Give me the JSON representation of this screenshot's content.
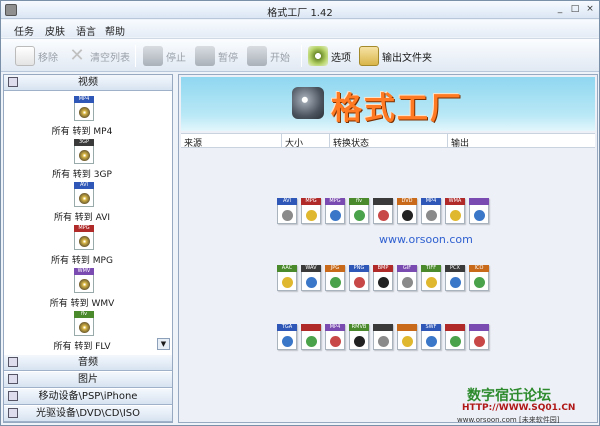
{
  "window": {
    "title": "格式工厂 1.42",
    "minimize": "_",
    "maximize": "□",
    "close": "×"
  },
  "menu": [
    "任务",
    "皮肤",
    "语言",
    "帮助"
  ],
  "toolbar": {
    "remove": "移除",
    "clear_list": "清空列表",
    "stop": "停止",
    "pause": "暂停",
    "start": "开始",
    "options": "选项",
    "output_folder": "输出文件夹"
  },
  "sidebar": {
    "video_section": "视频",
    "conversions": [
      {
        "label": "所有 转到 MP4",
        "tag": "MP4",
        "color": "#2f57b8"
      },
      {
        "label": "所有 转到 3GP",
        "tag": "3GP",
        "color": "#3a3a3a"
      },
      {
        "label": "所有 转到 AVI",
        "tag": "AVI",
        "color": "#2f57b8"
      },
      {
        "label": "所有 转到 MPG",
        "tag": "MPG",
        "color": "#b02a2a"
      },
      {
        "label": "所有 转到 WMV",
        "tag": "WMV",
        "color": "#7a4bb0"
      },
      {
        "label": "所有 转到 FLV",
        "tag": "flv",
        "color": "#4a8a2c"
      }
    ],
    "audio_section": "音频",
    "image_section": "图片",
    "mobile_section": "移动设备\\PSP\\iPhone",
    "disc_section": "光驱设备\\DVD\\CD\\ISO"
  },
  "banner": {
    "logo_text": "格式工厂"
  },
  "columns": [
    "来源",
    "大小",
    "转换状态",
    "输出"
  ],
  "icon_rows": [
    [
      "AVI",
      "MPG",
      "MPG",
      "flv",
      "",
      "DVD",
      "MP4",
      "WMA",
      ""
    ],
    [
      "AAC",
      "WAV",
      "JPG",
      "PNG",
      "BMP",
      "GIF",
      "TIFF",
      "PCX",
      "ICO"
    ],
    [
      "TGA",
      "",
      "MP4",
      "RMVB",
      "",
      "",
      "SWF",
      "",
      ""
    ]
  ],
  "watermarks": {
    "center": "www.orsoon.com",
    "forum": "数字宿迁论坛",
    "url": "HTTP://WWW.SQ01.CN",
    "footer": "www.orsoon.com [未来软件园]"
  }
}
